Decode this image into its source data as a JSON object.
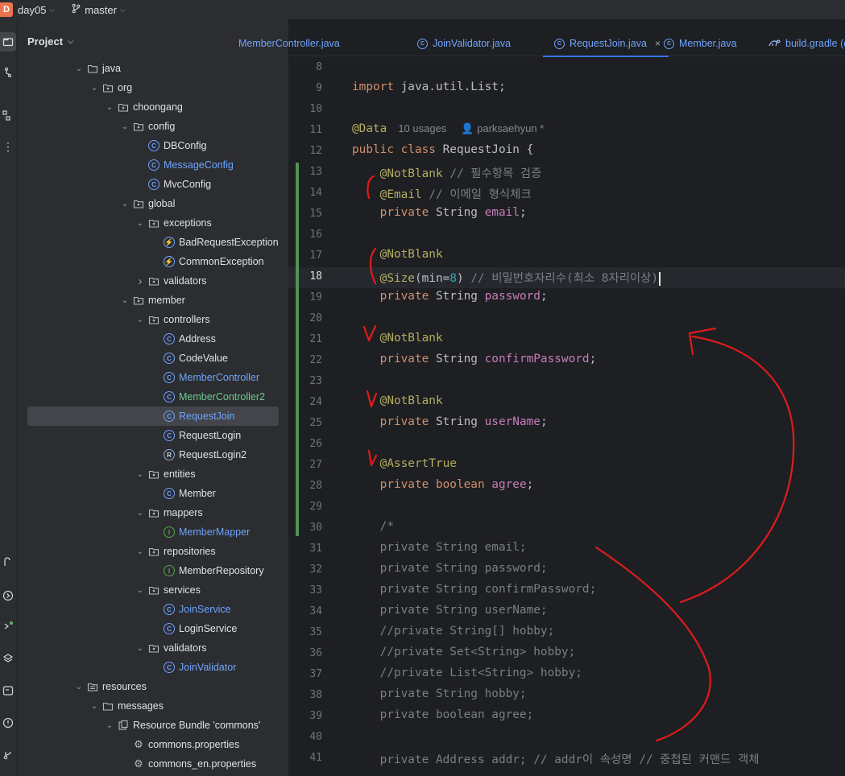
{
  "titlebar": {
    "project_badge": "D",
    "project_name": "day05",
    "branch": "master"
  },
  "project_panel": {
    "title": "Project",
    "tree": [
      {
        "label": "java",
        "icon": "folder-icon",
        "arrow": "down",
        "indent": 0,
        "color": "normal"
      },
      {
        "label": "org",
        "icon": "package-icon",
        "arrow": "down",
        "indent": 1,
        "color": "normal"
      },
      {
        "label": "choongang",
        "icon": "package-icon",
        "arrow": "down",
        "indent": 2,
        "color": "normal"
      },
      {
        "label": "config",
        "icon": "package-icon",
        "arrow": "down",
        "indent": 3,
        "color": "normal"
      },
      {
        "label": "DBConfig",
        "icon": "class-icon",
        "arrow": "",
        "indent": 4,
        "color": "normal"
      },
      {
        "label": "MessageConfig",
        "icon": "class-icon",
        "arrow": "",
        "indent": 4,
        "color": "blue"
      },
      {
        "label": "MvcConfig",
        "icon": "class-icon",
        "arrow": "",
        "indent": 4,
        "color": "normal"
      },
      {
        "label": "global",
        "icon": "package-icon",
        "arrow": "down",
        "indent": 3,
        "color": "normal"
      },
      {
        "label": "exceptions",
        "icon": "package-icon",
        "arrow": "down",
        "indent": 4,
        "color": "normal"
      },
      {
        "label": "BadRequestException",
        "icon": "exception-icon",
        "arrow": "",
        "indent": 5,
        "color": "normal"
      },
      {
        "label": "CommonException",
        "icon": "exception-icon",
        "arrow": "",
        "indent": 5,
        "color": "normal"
      },
      {
        "label": "validators",
        "icon": "package-icon",
        "arrow": "right",
        "indent": 4,
        "color": "normal"
      },
      {
        "label": "member",
        "icon": "package-icon",
        "arrow": "down",
        "indent": 3,
        "color": "normal"
      },
      {
        "label": "controllers",
        "icon": "package-icon",
        "arrow": "down",
        "indent": 4,
        "color": "normal"
      },
      {
        "label": "Address",
        "icon": "class-icon",
        "arrow": "",
        "indent": 5,
        "color": "normal"
      },
      {
        "label": "CodeValue",
        "icon": "class-icon",
        "arrow": "",
        "indent": 5,
        "color": "normal"
      },
      {
        "label": "MemberController",
        "icon": "class-icon",
        "arrow": "",
        "indent": 5,
        "color": "blue"
      },
      {
        "label": "MemberController2",
        "icon": "class-icon",
        "arrow": "",
        "indent": 5,
        "color": "green"
      },
      {
        "label": "RequestJoin",
        "icon": "class-icon",
        "arrow": "",
        "indent": 5,
        "color": "blue",
        "selected": true
      },
      {
        "label": "RequestLogin",
        "icon": "class-icon",
        "arrow": "",
        "indent": 5,
        "color": "normal"
      },
      {
        "label": "RequestLogin2",
        "icon": "record-icon",
        "arrow": "",
        "indent": 5,
        "color": "normal"
      },
      {
        "label": "entities",
        "icon": "package-icon",
        "arrow": "down",
        "indent": 4,
        "color": "normal"
      },
      {
        "label": "Member",
        "icon": "class-icon",
        "arrow": "",
        "indent": 5,
        "color": "normal"
      },
      {
        "label": "mappers",
        "icon": "package-icon",
        "arrow": "down",
        "indent": 4,
        "color": "normal"
      },
      {
        "label": "MemberMapper",
        "icon": "interface-icon",
        "arrow": "",
        "indent": 5,
        "color": "blue"
      },
      {
        "label": "repositories",
        "icon": "package-icon",
        "arrow": "down",
        "indent": 4,
        "color": "normal"
      },
      {
        "label": "MemberRepository",
        "icon": "interface-icon",
        "arrow": "",
        "indent": 5,
        "color": "normal"
      },
      {
        "label": "services",
        "icon": "package-icon",
        "arrow": "down",
        "indent": 4,
        "color": "normal"
      },
      {
        "label": "JoinService",
        "icon": "class-icon",
        "arrow": "",
        "indent": 5,
        "color": "blue"
      },
      {
        "label": "LoginService",
        "icon": "class-icon",
        "arrow": "",
        "indent": 5,
        "color": "normal"
      },
      {
        "label": "validators",
        "icon": "package-icon",
        "arrow": "down",
        "indent": 4,
        "color": "normal"
      },
      {
        "label": "JoinValidator",
        "icon": "class-icon",
        "arrow": "",
        "indent": 5,
        "color": "blue"
      },
      {
        "label": "resources",
        "icon": "resources-folder-icon",
        "arrow": "down",
        "indent": 0,
        "color": "normal"
      },
      {
        "label": "messages",
        "icon": "folder-icon",
        "arrow": "down",
        "indent": 1,
        "color": "normal"
      },
      {
        "label": "Resource Bundle 'commons'",
        "icon": "bundle-icon",
        "arrow": "down",
        "indent": 2,
        "color": "normal"
      },
      {
        "label": "commons.properties",
        "icon": "properties-icon",
        "arrow": "",
        "indent": 3,
        "color": "normal"
      },
      {
        "label": "commons_en.properties",
        "icon": "properties-icon",
        "arrow": "",
        "indent": 3,
        "color": "normal"
      }
    ]
  },
  "tabs": [
    {
      "label": "MemberController.java",
      "icon": "class-icon",
      "active": false
    },
    {
      "label": "JoinValidator.java",
      "icon": "class-icon",
      "active": false
    },
    {
      "label": "RequestJoin.java",
      "icon": "class-icon",
      "active": true
    },
    {
      "label": "Member.java",
      "icon": "class-icon",
      "active": false
    },
    {
      "label": "build.gradle (d",
      "icon": "gradle-icon",
      "active": false
    }
  ],
  "editor": {
    "current_line": 18,
    "usage_hint": "10 usages",
    "author_hint": "parksaehyun *",
    "lines": [
      {
        "n": "8",
        "html": ""
      },
      {
        "n": "9",
        "html": "<span class=\"kw\">import</span> java.util.List;"
      },
      {
        "n": "10",
        "html": ""
      },
      {
        "n": "11",
        "html": "<span class=\"ann\">@Data</span>"
      },
      {
        "n": "12",
        "html": "<span class=\"kw\">public class</span> RequestJoin {"
      },
      {
        "n": "13",
        "html": "    <span class=\"ann\">@NotBlank</span> <span class=\"cmt\">// 필수항목 검증</span>"
      },
      {
        "n": "14",
        "html": "    <span class=\"ann\">@Email</span> <span class=\"cmt\">// 이메일 형식체크</span>"
      },
      {
        "n": "15",
        "html": "    <span class=\"kw\">private</span> String <span class=\"fld\">email</span>;"
      },
      {
        "n": "16",
        "html": ""
      },
      {
        "n": "17",
        "html": "    <span class=\"ann\">@NotBlank</span>"
      },
      {
        "n": "18",
        "html": "    <span class=\"ann\">@Size</span>(min=<span class=\"num\">8</span>) <span class=\"cmt\">// 비밀번호자리수(최소 8자리이상)</span><span class=\"caret\"></span>"
      },
      {
        "n": "19",
        "html": "    <span class=\"kw\">private</span> String <span class=\"fld\">password</span>;"
      },
      {
        "n": "20",
        "html": ""
      },
      {
        "n": "21",
        "html": "    <span class=\"ann\">@NotBlank</span>"
      },
      {
        "n": "22",
        "html": "    <span class=\"kw\">private</span> String <span class=\"fld\">confirmPassword</span>;"
      },
      {
        "n": "23",
        "html": ""
      },
      {
        "n": "24",
        "html": "    <span class=\"ann\">@NotBlank</span>"
      },
      {
        "n": "25",
        "html": "    <span class=\"kw\">private</span> String <span class=\"fld\">userName</span>;"
      },
      {
        "n": "26",
        "html": ""
      },
      {
        "n": "27",
        "html": "    <span class=\"ann\">@AssertTrue</span>"
      },
      {
        "n": "28",
        "html": "    <span class=\"kw\">private boolean</span> <span class=\"fld\">agree</span>;"
      },
      {
        "n": "29",
        "html": ""
      },
      {
        "n": "30",
        "html": "    <span class=\"cmt\">/*</span>"
      },
      {
        "n": "31",
        "html": "    <span class=\"cmt\">private String email;</span>"
      },
      {
        "n": "32",
        "html": "    <span class=\"cmt\">private String password;</span>"
      },
      {
        "n": "33",
        "html": "    <span class=\"cmt\">private String confirmPassword;</span>"
      },
      {
        "n": "34",
        "html": "    <span class=\"cmt\">private String userName;</span>"
      },
      {
        "n": "35",
        "html": "    <span class=\"cmt\">//private String[] hobby;</span>"
      },
      {
        "n": "36",
        "html": "    <span class=\"cmt\">//private Set&lt;String&gt; hobby;</span>"
      },
      {
        "n": "37",
        "html": "    <span class=\"cmt\">//private List&lt;String&gt; hobby;</span>"
      },
      {
        "n": "38",
        "html": "    <span class=\"cmt\">private String hobby;</span>"
      },
      {
        "n": "39",
        "html": "    <span class=\"cmt\">private boolean agree;</span>"
      },
      {
        "n": "40",
        "html": ""
      },
      {
        "n": "41",
        "html": "    <span class=\"cmt\">private Address addr; // addr이 속성명 // 중첩된 커맨드 객체</span>"
      }
    ]
  },
  "colors": {
    "annotation_ink": "#e01b1b",
    "accent": "#3574f0"
  }
}
